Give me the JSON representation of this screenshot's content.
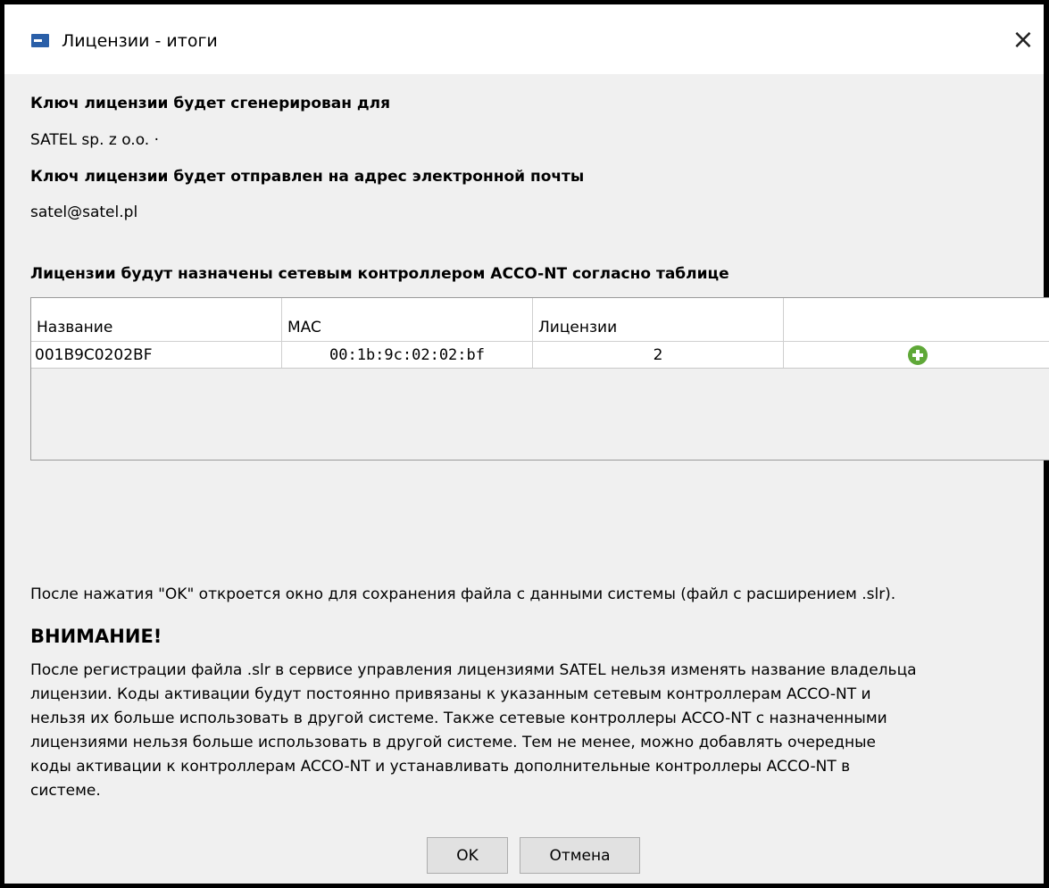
{
  "window": {
    "title": "Лицензии - итоги"
  },
  "content": {
    "key_for_heading": "Ключ лицензии будет сгенерирован для",
    "key_for_value": "SATEL sp. z o.o. ·",
    "email_heading": "Ключ лицензии будет отправлен на адрес электронной почты",
    "email_value": "satel@satel.pl",
    "table_heading": "Лицензии будут назначены сетевым контроллером  ACCO-NT  согласно таблице",
    "table": {
      "columns": [
        "Название",
        "MAC",
        "Лицензии",
        ""
      ],
      "rows": [
        {
          "name": "001B9C0202BF",
          "mac": "00:1b:9c:02:02:bf",
          "licenses": "2",
          "action_icon": "add-icon"
        }
      ]
    },
    "note": "После нажатия \"OK\" откроется окно для сохранения файла с данными системы (файл с расширением .slr).",
    "warning_heading": "ВНИМАНИЕ!",
    "warning_lines": [
      "После регистрации файла .slr в сервисе управления лицензиями SATEL нельзя изменять название владельца",
      "лицензии. Коды активации будут постоянно привязаны к указанным сетевым контроллерам ACCO-NT и",
      "нельзя их больше использовать в другой системе. Также сетевые контроллеры ACCO-NT с назначенными",
      "лицензиями нельзя больше использовать в другой системе. Тем не менее, можно добавлять очередные",
      "коды активации к контроллерам ACCO-NT и устанавливать дополнительные контроллеры ACCO-NT в",
      "системе."
    ]
  },
  "buttons": {
    "ok_label": "OK",
    "cancel_label": "Отмена"
  },
  "colors": {
    "add_icon": "#5fa838",
    "dialog_bg": "#f0f0f0"
  }
}
